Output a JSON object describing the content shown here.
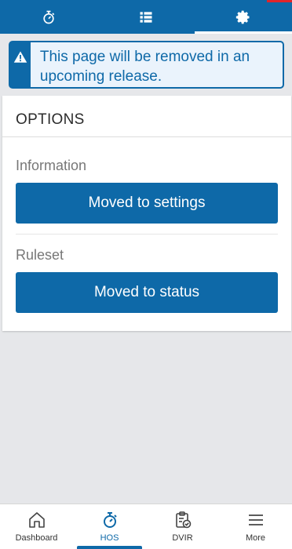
{
  "top_tabs": [
    {
      "icon": "stopwatch-icon",
      "active": false
    },
    {
      "icon": "list-icon",
      "active": false
    },
    {
      "icon": "gear-icon",
      "active": true
    }
  ],
  "alert": {
    "icon": "warning-icon",
    "text": "This page will be removed in an upcoming release."
  },
  "options": {
    "title": "OPTIONS",
    "sections": [
      {
        "label": "Information",
        "button": "Moved to settings"
      },
      {
        "label": "Ruleset",
        "button": "Moved to status"
      }
    ]
  },
  "bottom_nav": [
    {
      "label": "Dashboard",
      "icon": "home-icon",
      "active": false
    },
    {
      "label": "HOS",
      "icon": "stopwatch-icon",
      "active": true
    },
    {
      "label": "DVIR",
      "icon": "clipboard-check-icon",
      "active": false
    },
    {
      "label": "More",
      "icon": "menu-icon",
      "active": false
    }
  ],
  "colors": {
    "brand": "#0e69a8",
    "background": "#e6e7ea",
    "alert_bg": "#eaf3fc",
    "accent_red": "#e0252b"
  }
}
